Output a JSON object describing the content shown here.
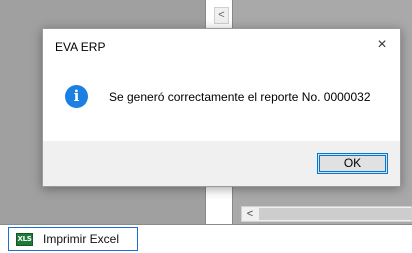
{
  "background": {
    "scroll_up_glyph": "<",
    "scroll_left_glyph": "<"
  },
  "toolbar": {
    "excel_button_label": "Imprimir Excel",
    "excel_icon_text": "XLS"
  },
  "dialog": {
    "title": "EVA ERP",
    "close_glyph": "×",
    "icon": "info-icon",
    "message": "Se generó correctamente el reporte No. 0000032",
    "ok_label": "OK"
  },
  "colors": {
    "accent": "#0078d7",
    "info_icon": "#1c7fe3",
    "excel_icon": "#1f7a3a"
  }
}
